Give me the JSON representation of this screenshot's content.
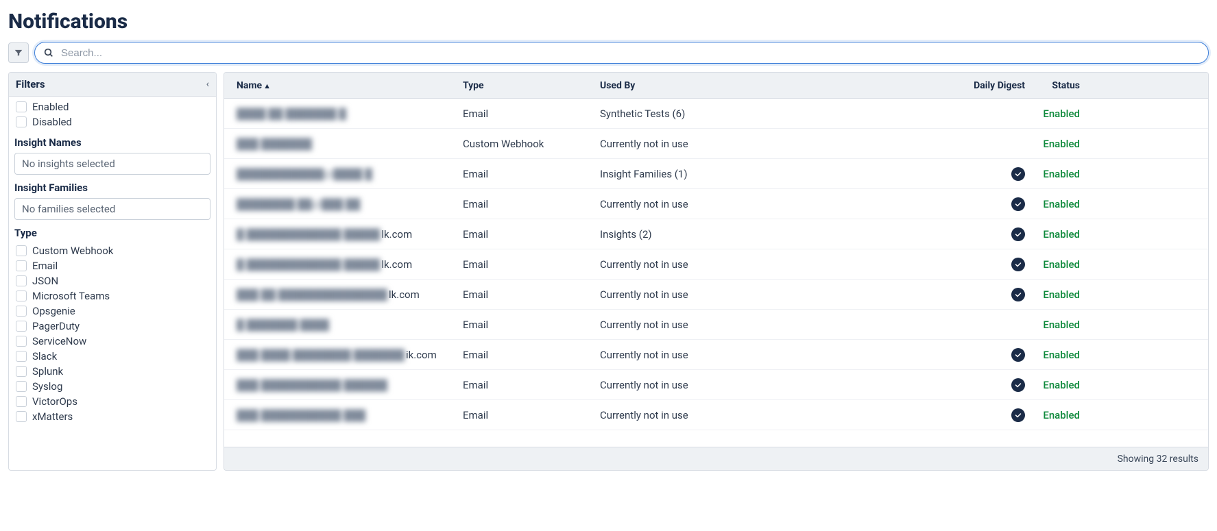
{
  "page_title": "Notifications",
  "search": {
    "placeholder": "Search..."
  },
  "filters": {
    "heading": "Filters",
    "state": [
      {
        "label": "Enabled"
      },
      {
        "label": "Disabled"
      }
    ],
    "insight_names": {
      "title": "Insight Names",
      "placeholder": "No insights selected"
    },
    "insight_families": {
      "title": "Insight Families",
      "placeholder": "No families selected"
    },
    "type_title": "Type",
    "types": [
      {
        "label": "Custom Webhook"
      },
      {
        "label": "Email"
      },
      {
        "label": "JSON"
      },
      {
        "label": "Microsoft Teams"
      },
      {
        "label": "Opsgenie"
      },
      {
        "label": "PagerDuty"
      },
      {
        "label": "ServiceNow"
      },
      {
        "label": "Slack"
      },
      {
        "label": "Splunk"
      },
      {
        "label": "Syslog"
      },
      {
        "label": "VictorOps"
      },
      {
        "label": "xMatters"
      }
    ]
  },
  "table": {
    "columns": {
      "name": "Name",
      "type": "Type",
      "used_by": "Used By",
      "daily_digest": "Daily Digest",
      "status": "Status"
    },
    "rows": [
      {
        "name_obscured": "████ ██ ███████ █",
        "name_suffix": "",
        "type": "Email",
        "used_by": "Synthetic Tests (6)",
        "digest": false,
        "status": "Enabled"
      },
      {
        "name_obscured": "███ ███████",
        "name_suffix": "",
        "type": "Custom Webhook",
        "used_by": "Currently not in use",
        "digest": false,
        "status": "Enabled"
      },
      {
        "name_obscured": "████████████@████ █",
        "name_suffix": "",
        "type": "Email",
        "used_by": "Insight Families (1)",
        "digest": true,
        "status": "Enabled"
      },
      {
        "name_obscured": "████████ ██@███ ██",
        "name_suffix": "",
        "type": "Email",
        "used_by": "Currently not in use",
        "digest": true,
        "status": "Enabled"
      },
      {
        "name_obscured": "█ █████████████ █████",
        "name_suffix": "lk.com",
        "type": "Email",
        "used_by": "Insights (2)",
        "digest": true,
        "status": "Enabled"
      },
      {
        "name_obscured": "█ █████████████ █████",
        "name_suffix": "lk.com",
        "type": "Email",
        "used_by": "Currently not in use",
        "digest": true,
        "status": "Enabled"
      },
      {
        "name_obscured": "███ ██ ███████████████",
        "name_suffix": "lk.com",
        "type": "Email",
        "used_by": "Currently not in use",
        "digest": true,
        "status": "Enabled"
      },
      {
        "name_obscured": "█ ███████ ████",
        "name_suffix": "",
        "type": "Email",
        "used_by": "Currently not in use",
        "digest": false,
        "status": "Enabled"
      },
      {
        "name_obscured": "███ ████ ████████ ███████",
        "name_suffix": "ik.com",
        "type": "Email",
        "used_by": "Currently not in use",
        "digest": true,
        "status": "Enabled"
      },
      {
        "name_obscured": "███ ███████████ ██████",
        "name_suffix": "",
        "type": "Email",
        "used_by": "Currently not in use",
        "digest": true,
        "status": "Enabled"
      },
      {
        "name_obscured": "███ ███████████ ███",
        "name_suffix": "",
        "type": "Email",
        "used_by": "Currently not in use",
        "digest": true,
        "status": "Enabled"
      }
    ],
    "results_text": "Showing 32 results"
  }
}
